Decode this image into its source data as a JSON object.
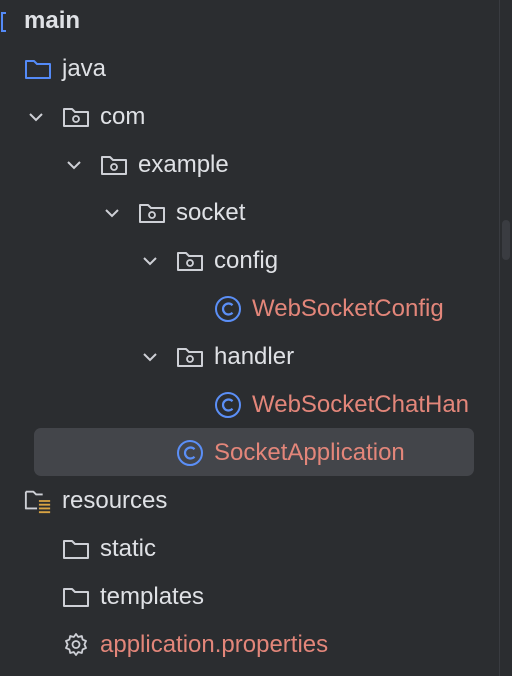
{
  "project_tree": {
    "rows": [
      {
        "label": "main",
        "icon": "module-folder-icon",
        "bold": true
      },
      {
        "label": "java",
        "icon": "source-folder-icon"
      },
      {
        "label": "com",
        "icon": "package-icon",
        "expanded": true
      },
      {
        "label": "example",
        "icon": "package-icon",
        "expanded": true
      },
      {
        "label": "socket",
        "icon": "package-icon",
        "expanded": true
      },
      {
        "label": "config",
        "icon": "package-icon",
        "expanded": true
      },
      {
        "label": "WebSocketConfig",
        "icon": "class-icon",
        "modified": true
      },
      {
        "label": "handler",
        "icon": "package-icon",
        "expanded": true
      },
      {
        "label": "WebSocketChatHan",
        "icon": "class-icon",
        "modified": true
      },
      {
        "label": "SocketApplication",
        "icon": "class-icon",
        "modified": true,
        "selected": true
      },
      {
        "label": "resources",
        "icon": "resources-folder-icon"
      },
      {
        "label": "static",
        "icon": "folder-icon"
      },
      {
        "label": "templates",
        "icon": "folder-icon"
      },
      {
        "label": "application.properties",
        "icon": "gear-icon",
        "modified": true
      }
    ]
  },
  "colors": {
    "background": "#2b2d30",
    "text": "#dfe1e5",
    "modified_text": "#e3867a",
    "selection": "#43454a",
    "folder_blue": "#548af7",
    "class_blue": "#5b8ff7",
    "icon_gray": "#ced0d6"
  }
}
